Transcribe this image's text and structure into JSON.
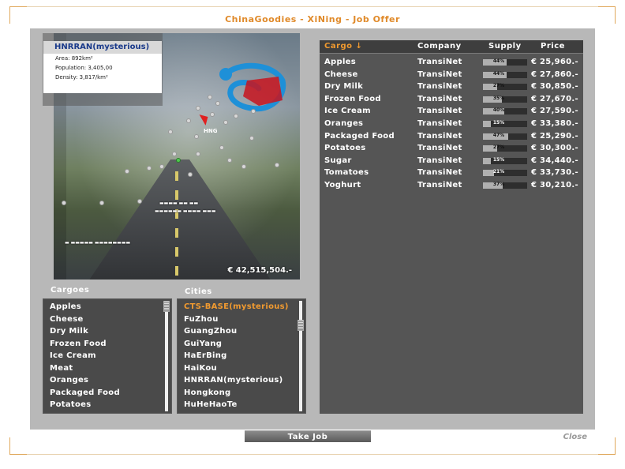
{
  "window": {
    "title": "ChinaGoodies - XiNing - Job Offer"
  },
  "city_info": {
    "name": "HNRRAN(mysterious)",
    "area": "Area: 892km²",
    "population": "Population: 3,405,00",
    "density": "Density: 3,817/km²"
  },
  "photo": {
    "marker_label": "HNG",
    "money": "€ 42,515,504.-"
  },
  "cargoes": {
    "title": "Cargoes",
    "items": [
      "Apples",
      "Cheese",
      "Dry Milk",
      "Frozen Food",
      "Ice Cream",
      "Meat",
      "Oranges",
      "Packaged Food",
      "Potatoes"
    ]
  },
  "cities": {
    "title": "Cities",
    "items": [
      "CTS-BASE(mysterious)",
      "FuZhou",
      "GuangZhou",
      "GuiYang",
      "HaErBing",
      "HaiKou",
      "HNRRAN(mysterious)",
      "Hongkong",
      "HuHeHaoTe"
    ],
    "selected_index": 0
  },
  "offers": {
    "headers": {
      "cargo": "Cargo ↓",
      "company": "Company",
      "supply": "Supply",
      "price": "Price"
    },
    "rows": [
      {
        "cargo": "Apples",
        "company": "TransiNet",
        "supply": 44,
        "supply_label": "44%",
        "price": "€ 25,960.-"
      },
      {
        "cargo": "Cheese",
        "company": "TransiNet",
        "supply": 44,
        "supply_label": "44%",
        "price": "€ 27,860.-"
      },
      {
        "cargo": "Dry Milk",
        "company": "TransiNet",
        "supply": 27,
        "supply_label": "27%",
        "price": "€ 30,850.-"
      },
      {
        "cargo": "Frozen Food",
        "company": "TransiNet",
        "supply": 35,
        "supply_label": "35%",
        "price": "€ 27,670.-"
      },
      {
        "cargo": "Ice Cream",
        "company": "TransiNet",
        "supply": 40,
        "supply_label": "40%",
        "price": "€ 27,590.-"
      },
      {
        "cargo": "Oranges",
        "company": "TransiNet",
        "supply": 15,
        "supply_label": "15%",
        "price": "€ 33,380.-"
      },
      {
        "cargo": "Packaged Food",
        "company": "TransiNet",
        "supply": 47,
        "supply_label": "47%",
        "price": "€ 25,290.-"
      },
      {
        "cargo": "Potatoes",
        "company": "TransiNet",
        "supply": 27,
        "supply_label": "27%",
        "price": "€ 30,300.-"
      },
      {
        "cargo": "Sugar",
        "company": "TransiNet",
        "supply": 15,
        "supply_label": "15%",
        "price": "€ 34,440.-"
      },
      {
        "cargo": "Tomatoes",
        "company": "TransiNet",
        "supply": 21,
        "supply_label": "21%",
        "price": "€ 33,730.-"
      },
      {
        "cargo": "Yoghurt",
        "company": "TransiNet",
        "supply": 37,
        "supply_label": "37%",
        "price": "€ 30,210.-"
      }
    ]
  },
  "buttons": {
    "take_job": "Take Job",
    "close": "Close"
  },
  "colors": {
    "accent": "#f09a30",
    "title": "#e08a2a",
    "info_title": "#1a3a8a"
  },
  "icons": {
    "sort": "arrow-down-icon",
    "scroll_thumb": "scroll-grip-icon",
    "marker": "location-arrow-icon"
  }
}
